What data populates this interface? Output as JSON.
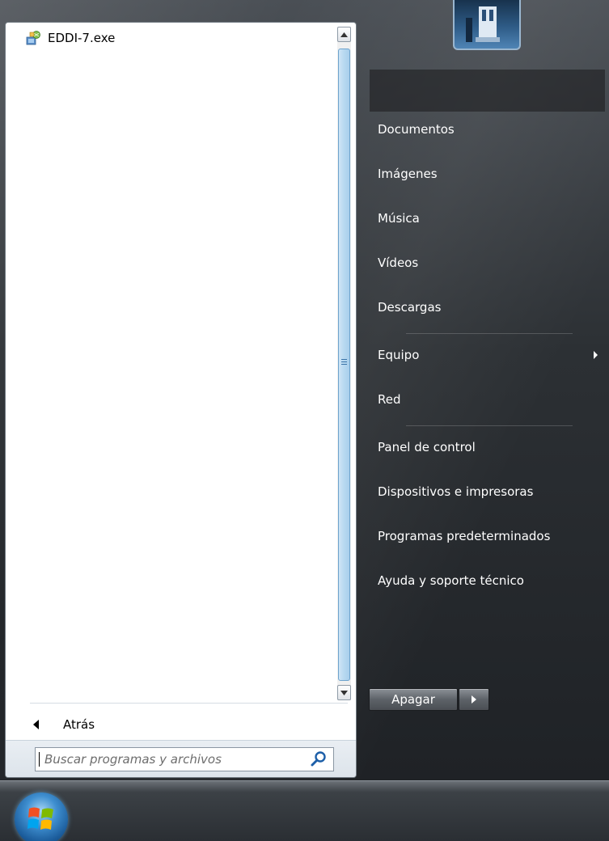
{
  "programs": [
    {
      "label": "EDDI-7.exe",
      "icon": "installer-icon"
    }
  ],
  "left": {
    "back_label": "Atrás",
    "search_placeholder": "Buscar programas y archivos"
  },
  "right": {
    "items": [
      {
        "label": "Documentos"
      },
      {
        "label": "Imágenes"
      },
      {
        "label": "Música"
      },
      {
        "label": "Vídeos"
      },
      {
        "label": "Descargas"
      },
      {
        "label": "Equipo"
      },
      {
        "label": "Red"
      },
      {
        "label": "Panel de control"
      },
      {
        "label": "Dispositivos e impresoras"
      },
      {
        "label": "Programas predeterminados"
      },
      {
        "label": "Ayuda y soporte técnico"
      }
    ],
    "shutdown_label": "Apagar"
  },
  "colors": {
    "menu_dark": "#2c3034",
    "scroll_thumb": "#b7d8f0",
    "text_light": "#ffffff"
  }
}
